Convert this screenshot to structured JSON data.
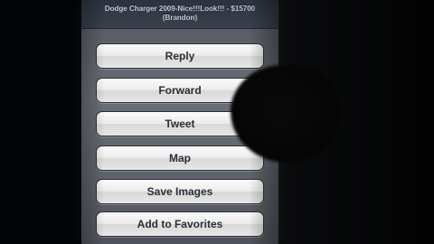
{
  "sheet": {
    "title_line1": "Dodge Charger 2009-Nice!!!Look!!! - $15700",
    "title_line2": "(Brandon)"
  },
  "actions": [
    {
      "label": "Reply"
    },
    {
      "label": "Forward"
    },
    {
      "label": "Tweet"
    },
    {
      "label": "Map"
    },
    {
      "label": "Save Images"
    },
    {
      "label": "Add to Favorites"
    }
  ]
}
